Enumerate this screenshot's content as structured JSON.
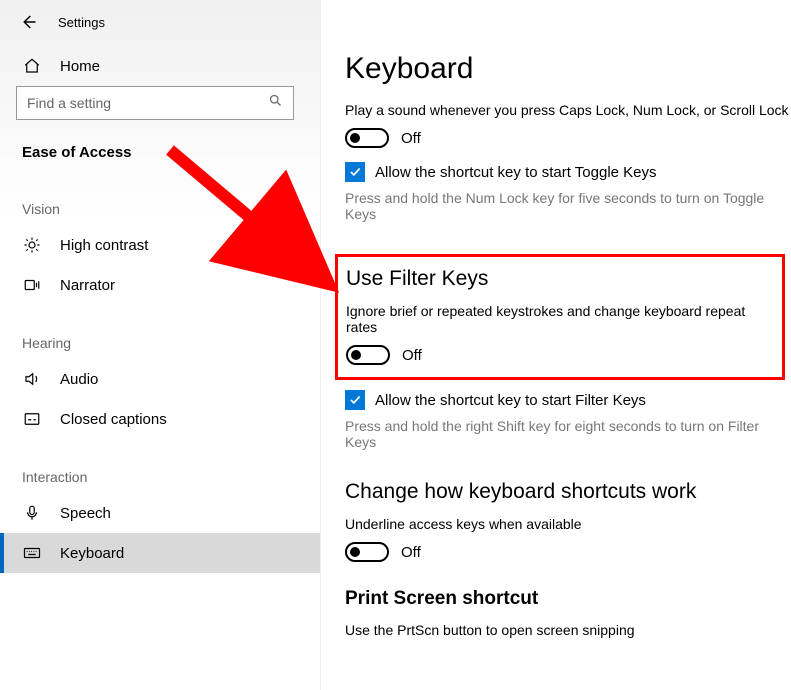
{
  "header": {
    "settings": "Settings"
  },
  "sidebar": {
    "home": "Home",
    "search_placeholder": "Find a setting",
    "section": "Ease of Access",
    "groups": {
      "vision": "Vision",
      "hearing": "Hearing",
      "interaction": "Interaction"
    },
    "items": {
      "high_contrast": "High contrast",
      "narrator": "Narrator",
      "audio": "Audio",
      "closed_captions": "Closed captions",
      "speech": "Speech",
      "keyboard": "Keyboard"
    }
  },
  "main": {
    "title": "Keyboard",
    "caps_desc": "Play a sound whenever you press Caps Lock, Num Lock, or Scroll Lock",
    "off": "Off",
    "toggle_keys_check": "Allow the shortcut key to start Toggle Keys",
    "toggle_keys_hint": "Press and hold the Num Lock key for five seconds to turn on Toggle Keys",
    "filter_title": "Use Filter Keys",
    "filter_desc": "Ignore brief or repeated keystrokes and change keyboard repeat rates",
    "filter_check": "Allow the shortcut key to start Filter Keys",
    "filter_hint": "Press and hold the right Shift key for eight seconds to turn on Filter Keys",
    "shortcuts_title": "Change how keyboard shortcuts work",
    "underline_desc": "Underline access keys when available",
    "printscreen_title": "Print Screen shortcut",
    "printscreen_desc": "Use the PrtScn button to open screen snipping"
  }
}
